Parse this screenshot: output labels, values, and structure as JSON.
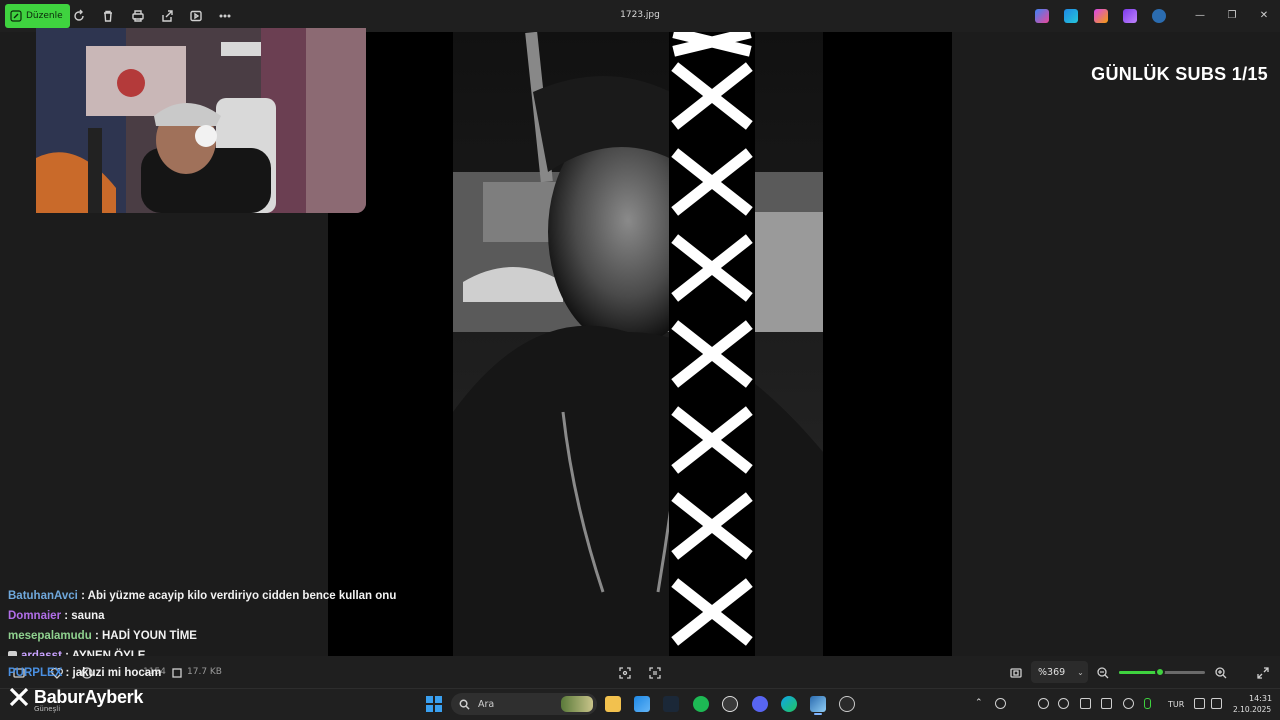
{
  "toolbar": {
    "edit_label": "Düzenle",
    "file_name": "1723.jpg"
  },
  "overlay": {
    "subs_counter": "GÜNLÜK SUBS 1/15"
  },
  "chat": [
    {
      "user": "BatuhanAvci",
      "user_color": "#6fa8dc",
      "message": ": Abi yüzme acayip kilo verdiriyo cidden bence kullan onu",
      "badge": false
    },
    {
      "user": "Domnaier",
      "user_color": "#b16ee8",
      "message": ": sauna",
      "badge": false
    },
    {
      "user": "mesepalamudu",
      "user_color": "#8fd18f",
      "message": ": HADİ YOUN TİME",
      "badge": false
    },
    {
      "user": "ardasst",
      "user_color": "#c9a3ff",
      "message": ": AYNEN ÖYLE",
      "badge": true
    },
    {
      "user": "PURPLEX",
      "user_color": "#4a90e2",
      "message": ": jakuzi mi hocam",
      "badge": false
    }
  ],
  "statusbar": {
    "dimensions": "1154",
    "file_size": "17.7 KB",
    "zoom_value": "%369",
    "zoom_level": 0.48
  },
  "brand": {
    "name": "BaburAyberk",
    "sub": "Güneşli"
  },
  "taskbar": {
    "search_placeholder": "Ara",
    "language": "TUR",
    "time": "14:31",
    "date": "2.10.2025"
  },
  "colors": {
    "accent": "#3fd33f",
    "background": "#1c1c1c"
  }
}
